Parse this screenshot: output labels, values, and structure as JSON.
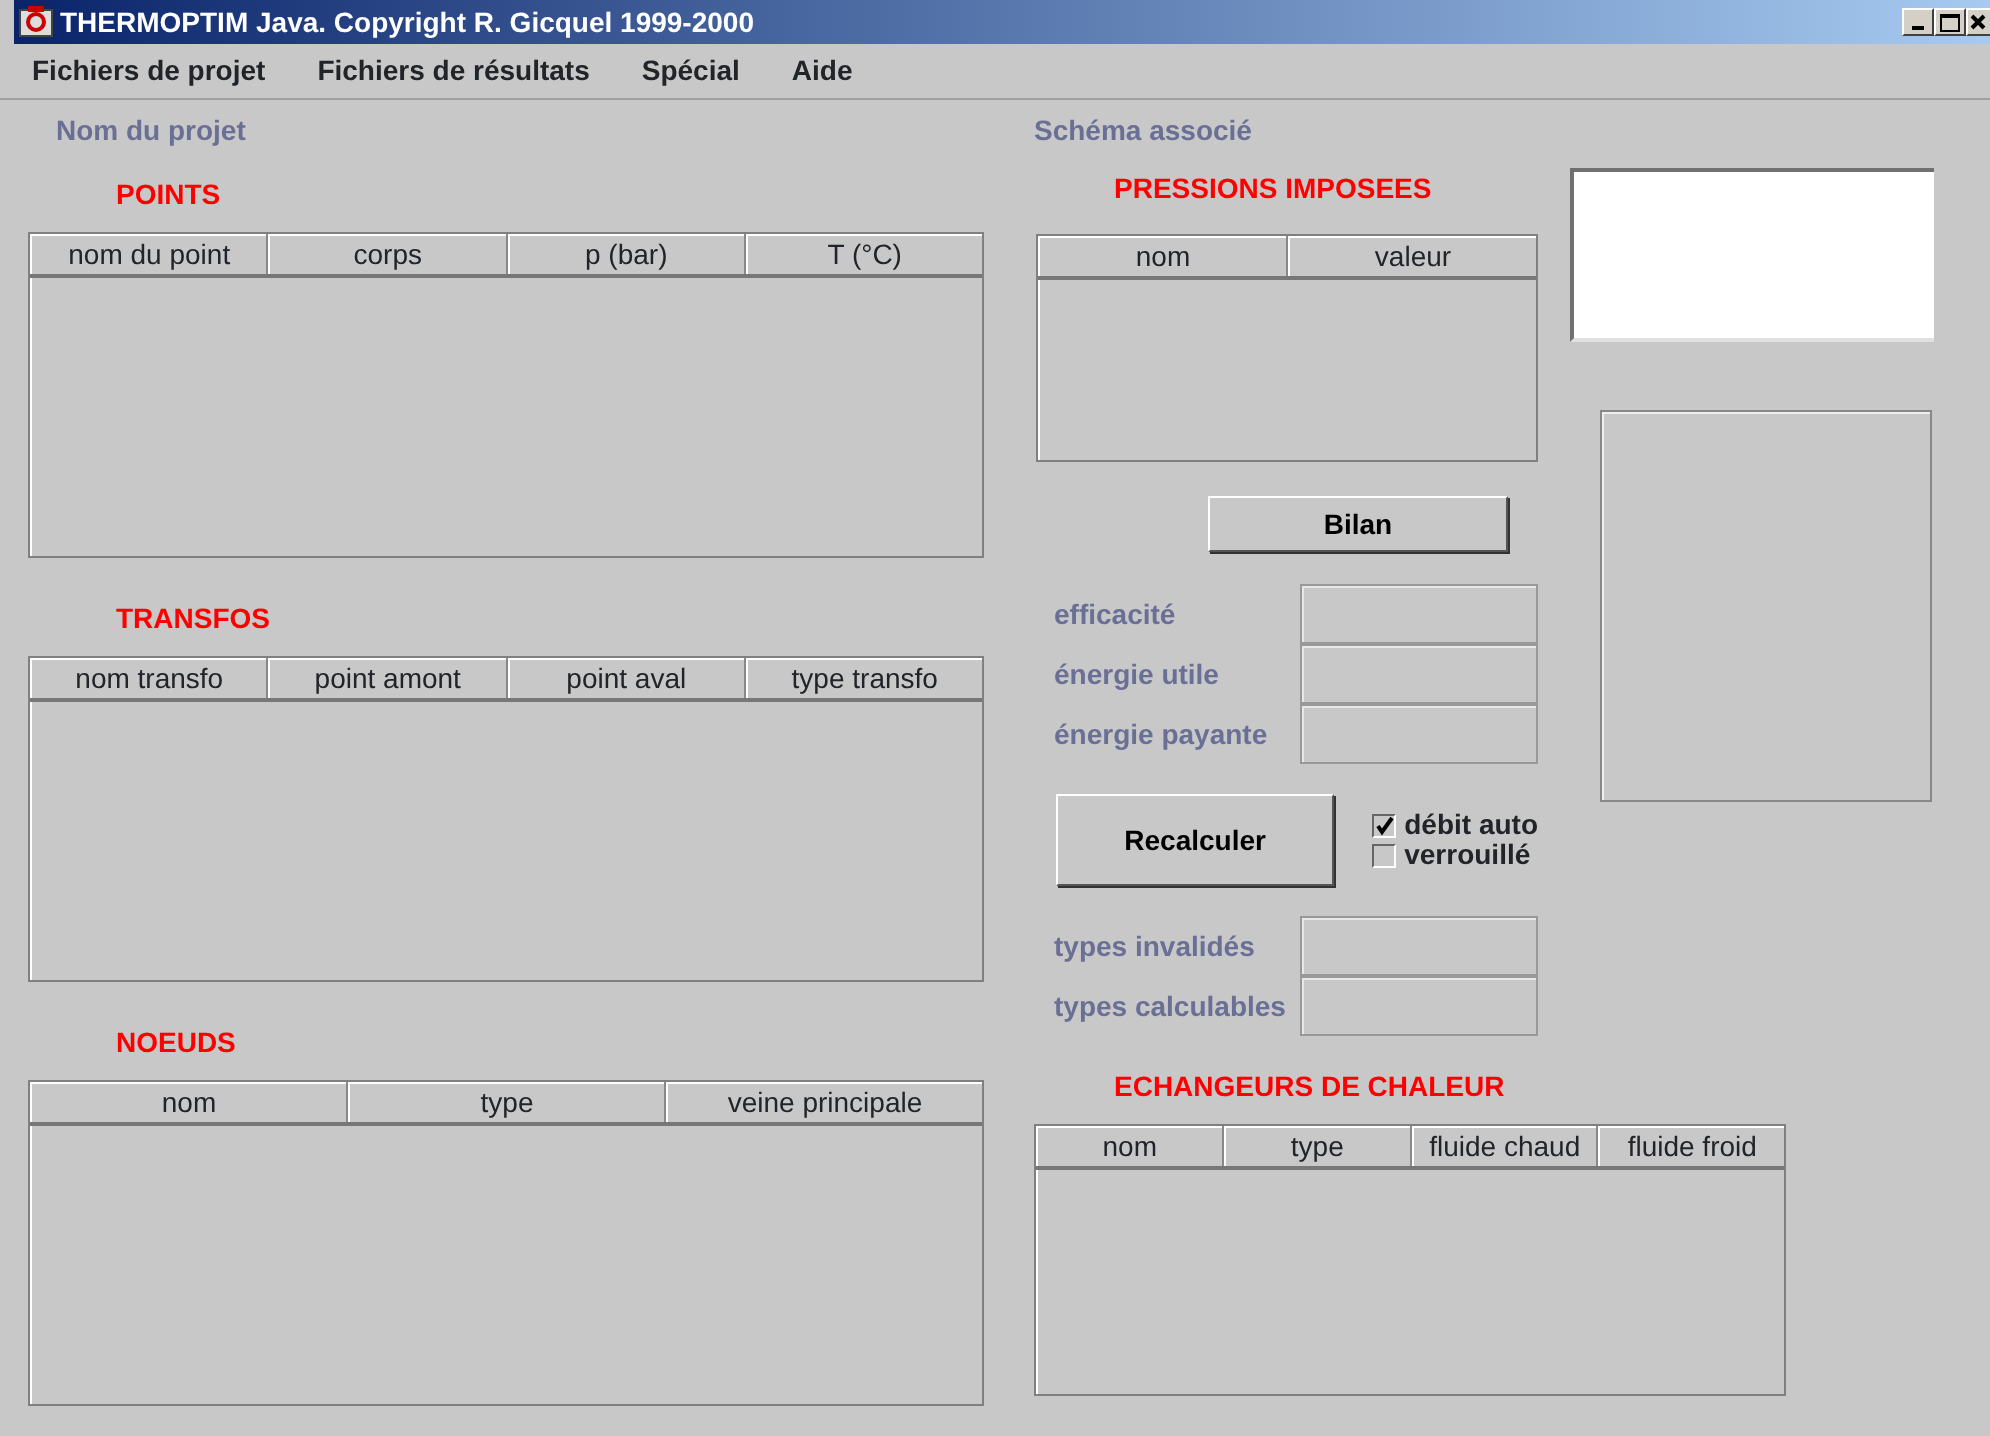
{
  "window": {
    "title": "THERMOPTIM Java. Copyright R. Gicquel 1999-2000"
  },
  "menu": [
    "Fichiers de projet",
    "Fichiers de résultats",
    "Spécial",
    "Aide"
  ],
  "project_label": "Nom du projet",
  "schema_label": "Schéma associé",
  "points": {
    "title": "POINTS",
    "columns": [
      "nom du point",
      "corps",
      "p (bar)",
      "T (°C)"
    ]
  },
  "transfos": {
    "title": "TRANSFOS",
    "columns": [
      "nom transfo",
      "point amont",
      "point aval",
      "type transfo"
    ]
  },
  "noeuds": {
    "title": "NOEUDS",
    "columns": [
      "nom",
      "type",
      "veine principale"
    ]
  },
  "pressions": {
    "title": "PRESSIONS IMPOSEES",
    "columns": [
      "nom",
      "valeur"
    ]
  },
  "bilan_button": "Bilan",
  "results": [
    {
      "label": "efficacité"
    },
    {
      "label": "énergie utile"
    },
    {
      "label": "énergie payante"
    }
  ],
  "recalc_button": "Recalculer",
  "options": [
    {
      "label": "débit auto",
      "checked": true
    },
    {
      "label": "verrouillé",
      "checked": false
    }
  ],
  "types": [
    {
      "label": "types invalidés"
    },
    {
      "label": "types calculables"
    }
  ],
  "echangeurs": {
    "title": "ECHANGEURS DE CHALEUR",
    "columns": [
      "nom",
      "type",
      "fluide chaud",
      "fluide froid"
    ]
  }
}
